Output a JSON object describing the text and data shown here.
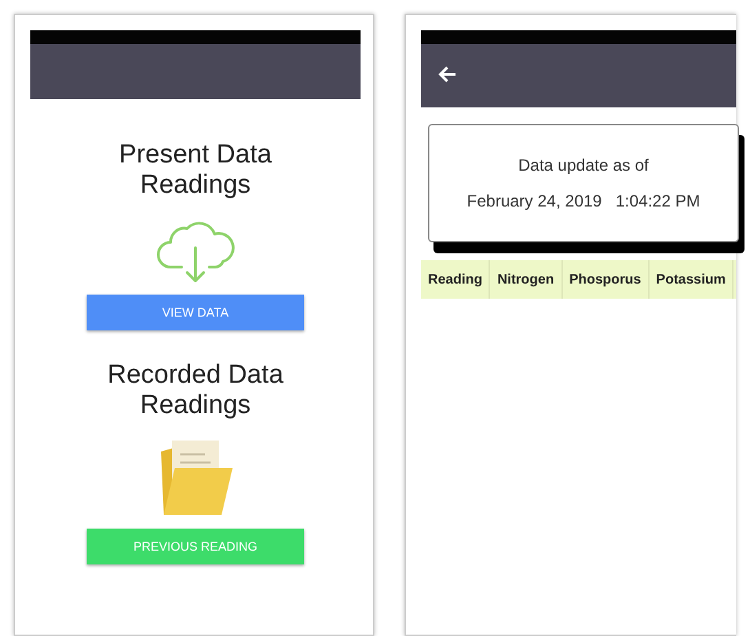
{
  "screens": [
    {
      "kind": "home",
      "sections": [
        {
          "heading": "Present Data Readings",
          "button": {
            "label": "VIEW DATA",
            "color": "#4f8ef7"
          }
        },
        {
          "heading": "Recorded Data Readings",
          "button": {
            "label": "PREVIOUS READING",
            "color": "#3ddc6a"
          }
        }
      ]
    },
    {
      "kind": "data",
      "update_label": "Data update as of",
      "date": "February 24, 2019",
      "time": "1:04:22 PM",
      "table": {
        "columns": [
          "Reading",
          "Nitrogen",
          "Phosporus",
          "Potassium"
        ]
      }
    }
  ]
}
